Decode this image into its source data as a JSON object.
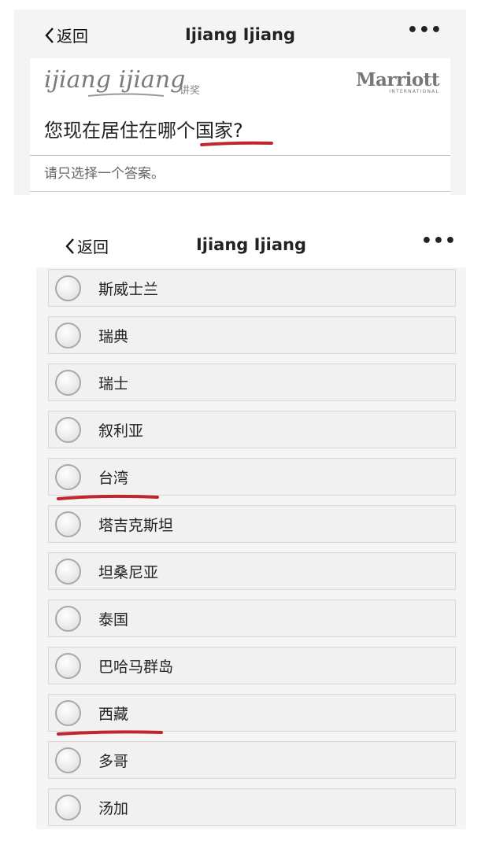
{
  "screen1": {
    "navbar": {
      "back_label": "返回",
      "title": "Ijiang Ijiang",
      "more_label": "•••"
    },
    "brand": {
      "logo_text": "ijiang ijiang",
      "sub_label": "讲奖"
    },
    "partner_logo": {
      "name": "Marriott",
      "tagline": "INTERNATIONAL"
    },
    "question": "您现在居住在哪个国家?",
    "instruction": "请只选择一个答案。"
  },
  "screen2": {
    "navbar": {
      "back_label": "返回",
      "title": "Ijiang Ijiang",
      "more_label": "•••"
    },
    "options": [
      {
        "label": "斯威士兰"
      },
      {
        "label": "瑞典"
      },
      {
        "label": "瑞士"
      },
      {
        "label": "叙利亚"
      },
      {
        "label": "台湾"
      },
      {
        "label": "塔吉克斯坦"
      },
      {
        "label": "坦桑尼亚"
      },
      {
        "label": "泰国"
      },
      {
        "label": "巴哈马群岛"
      },
      {
        "label": "西藏"
      },
      {
        "label": "多哥"
      },
      {
        "label": "汤加"
      }
    ]
  },
  "colors": {
    "annotation_red": "#c0262d"
  }
}
